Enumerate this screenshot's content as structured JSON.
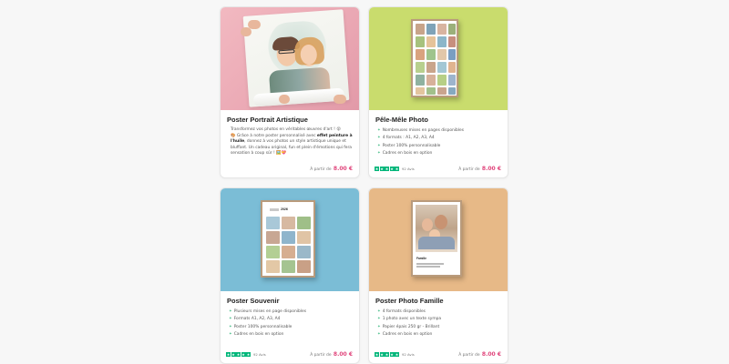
{
  "colors": {
    "accent_price": "#e0457b",
    "trustpilot_green": "#00b67a",
    "card_green_bg": "#c9dc6d",
    "card_blue_bg": "#7bbdd6",
    "card_tan_bg": "#e7b987",
    "card_pink_bg": "#eaa7b3"
  },
  "cards": [
    {
      "title": "Poster Portrait Artistique",
      "description_parts": [
        "Transformez vos photos en véritables œuvres d'art ! 😲",
        "🎨 Grâce à notre poster personnalisé avec ",
        "effet peinture à l'huile",
        ", donnez à vos photos un style artistique unique et bluffant. Un cadeau original, fun et plein d'émotions qui fera sensation à coup sûr ! 🖼️💝"
      ],
      "price_prefix": "À partir de",
      "price": "8.00 €",
      "image_icon": "artistic-portrait-photo"
    },
    {
      "title": "Pêle-Mêle Photo",
      "features": [
        "Nombreuses mises en pages disponibles",
        "4 formats : A1, A2, A3, A4",
        "Poster 100% personnalisable",
        "Cadres en bois en option"
      ],
      "reviews": "92 Avis",
      "price_prefix": "À partir de",
      "price": "8.00 €",
      "image_icon": "photo-collage-poster"
    },
    {
      "title": "Poster Souvenir",
      "image_text": "2026",
      "features": [
        "Plusieurs mises en page disponibles",
        "Formats A1, A2, A3, A4",
        "Poster 100% personnalisable",
        "Cadres en bois en option"
      ],
      "reviews": "92 Avis",
      "price_prefix": "À partir de",
      "price": "8.00 €",
      "image_icon": "calendar-poster"
    },
    {
      "title": "Poster Photo Famille",
      "image_text": "Famille",
      "features": [
        "4 formats disponibles",
        "1 photo avec un texte sympa",
        "Papier épais 250 gr - Brillant",
        "Cadres en bois en option"
      ],
      "reviews": "92 Avis",
      "price_prefix": "À partir de",
      "price": "8.00 €",
      "image_icon": "family-photo-poster"
    }
  ]
}
